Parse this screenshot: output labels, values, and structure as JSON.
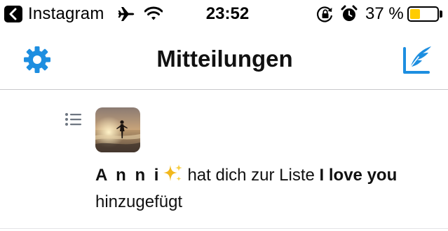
{
  "status_bar": {
    "back_app": "Instagram",
    "time": "23:52",
    "battery_percent_text": "37 %",
    "battery_level": 0.37,
    "battery_color": "#ffcc00",
    "icons": [
      "back-arrow-icon",
      "airplane-icon",
      "wifi-icon",
      "rotation-lock-icon",
      "alarm-icon",
      "battery-icon"
    ]
  },
  "nav": {
    "title": "Mitteilungen",
    "left_icon": "gear-icon",
    "right_icon": "compose-icon",
    "accent": "#1d8ee0"
  },
  "notification": {
    "type_icon": "list-icon",
    "avatar": "beach-sunset-avatar",
    "user": "A n n i",
    "user_emoji": "sparkles-icon",
    "text_before": "hat dich zur Liste",
    "list_name": "I love you",
    "text_after": "hinzugefügt"
  }
}
